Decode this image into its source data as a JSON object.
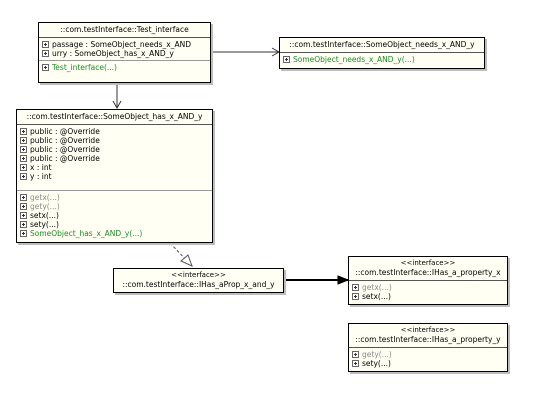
{
  "classes": {
    "test_interface": {
      "name": "::com.testInterface::Test_interface",
      "attributes": [
        "passage : SomeObject_needs_x_AND",
        "urry : SomeObject_has_x_AND_y"
      ],
      "operations": [
        "Test_interface(...)"
      ]
    },
    "needs_x_and_y": {
      "name": "::com.testInterface::SomeObject_needs_x_AND_y",
      "operations": [
        "SomeObject_needs_x_AND_y(...)"
      ]
    },
    "has_x_and_y": {
      "name": "::com.testInterface::SomeObject_has_x_AND_y",
      "attributes": [
        "public : @Override",
        "public : @Override",
        "public : @Override",
        "public : @Override",
        "x : int",
        "y : int"
      ],
      "operations": [
        "getx(...)",
        "gety(...)",
        "setx(...)",
        "sety(...)",
        "SomeObject_has_x_AND_y(...)"
      ]
    },
    "ihas_aprop": {
      "stereotype": "<<interface>>",
      "name": "::com.testInterface::IHas_aProp_x_and_y"
    },
    "ihas_prop_x": {
      "stereotype": "<<interface>>",
      "name": "::com.testInterface::IHas_a_property_x",
      "operations": [
        "getx(...)",
        "setx(...)"
      ]
    },
    "ihas_prop_y": {
      "stereotype": "<<interface>>",
      "name": "::com.testInterface::IHas_a_property_y",
      "operations": [
        "gety(...)",
        "sety(...)"
      ]
    }
  },
  "colors": {
    "box_fill": "#fffff4",
    "border": "#000000",
    "shadow": "#bdbdbd",
    "constructor_text": "#1f8a2a",
    "getter_text": "#8a8a8a"
  }
}
